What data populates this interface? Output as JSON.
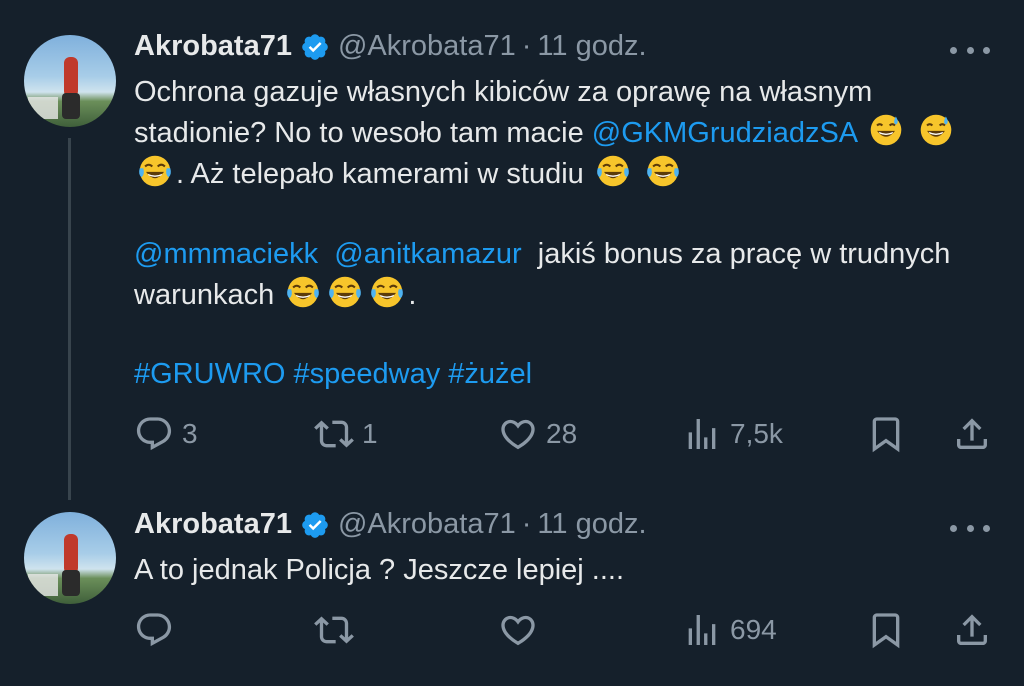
{
  "tweets": [
    {
      "author_name": "Akrobata71",
      "handle": "@Akrobata71",
      "separator": "·",
      "time": "11 godz.",
      "text": {
        "p1_a": "Ochrona gazuje własnych kibiców za oprawę na własnym stadionie? No to wesoło tam macie ",
        "p1_mention": "@GKMGrudziadzSA",
        "p1_b": ". Aż telepało kamerami w studiu",
        "p2_mention1": "@mmmaciekk",
        "p2_mention2": "@anitkamazur",
        "p2_a": " jakiś bonus za pracę w trudnych warunkach",
        "p2_b": ".",
        "hashtags": "#GRUWRO #speedway #żużel"
      },
      "stats": {
        "replies": "3",
        "retweets": "1",
        "likes": "28",
        "views": "7,5k"
      }
    },
    {
      "author_name": "Akrobata71",
      "handle": "@Akrobata71",
      "separator": "·",
      "time": "11 godz.",
      "text": "A to jednak Policja ? Jeszcze lepiej ....",
      "stats": {
        "views": "694"
      }
    }
  ],
  "icons": {
    "reply": "reply-icon",
    "retweet": "retweet-icon",
    "like": "like-icon",
    "views": "views-icon",
    "bookmark": "bookmark-icon",
    "share": "share-icon",
    "verified": "verified-badge-icon",
    "more": "more-icon",
    "emoji_sweat_smile": "grinning-sweat-emoji",
    "emoji_tears_joy": "tears-of-joy-emoji"
  },
  "colors": {
    "background": "#15202b",
    "text": "#e7e9ea",
    "secondary": "#8b98a5",
    "accent": "#1d9bf0"
  }
}
